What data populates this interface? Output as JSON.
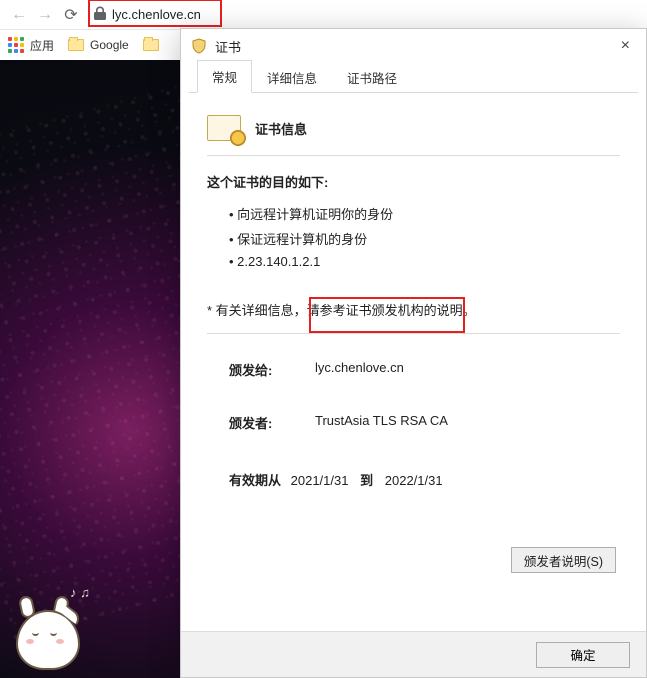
{
  "toolbar": {
    "url": "lyc.chenlove.cn"
  },
  "bookmarks": {
    "apps_label": "应用",
    "google": "Google"
  },
  "dialog": {
    "title": "证书",
    "close": "×",
    "tabs": {
      "general": "常规",
      "details": "详细信息",
      "path": "证书路径"
    },
    "cert_info_header": "证书信息",
    "purpose_title": "这个证书的目的如下:",
    "purpose_items": [
      "向远程计算机证明你的身份",
      "保证远程计算机的身份",
      "2.23.140.1.2.1"
    ],
    "note": "* 有关详细信息，请参考证书颁发机构的说明。",
    "issued_to_label": "颁发给:",
    "issued_to_value": "lyc.chenlove.cn",
    "issuer_label": "颁发者:",
    "issuer_value": "TrustAsia TLS RSA CA",
    "valid_from_label": "有效期从",
    "valid_from": "2021/1/31",
    "valid_to_label": "到",
    "valid_to": "2022/1/31",
    "issuer_statement_btn": "颁发者说明(S)",
    "ok_btn": "确定"
  }
}
